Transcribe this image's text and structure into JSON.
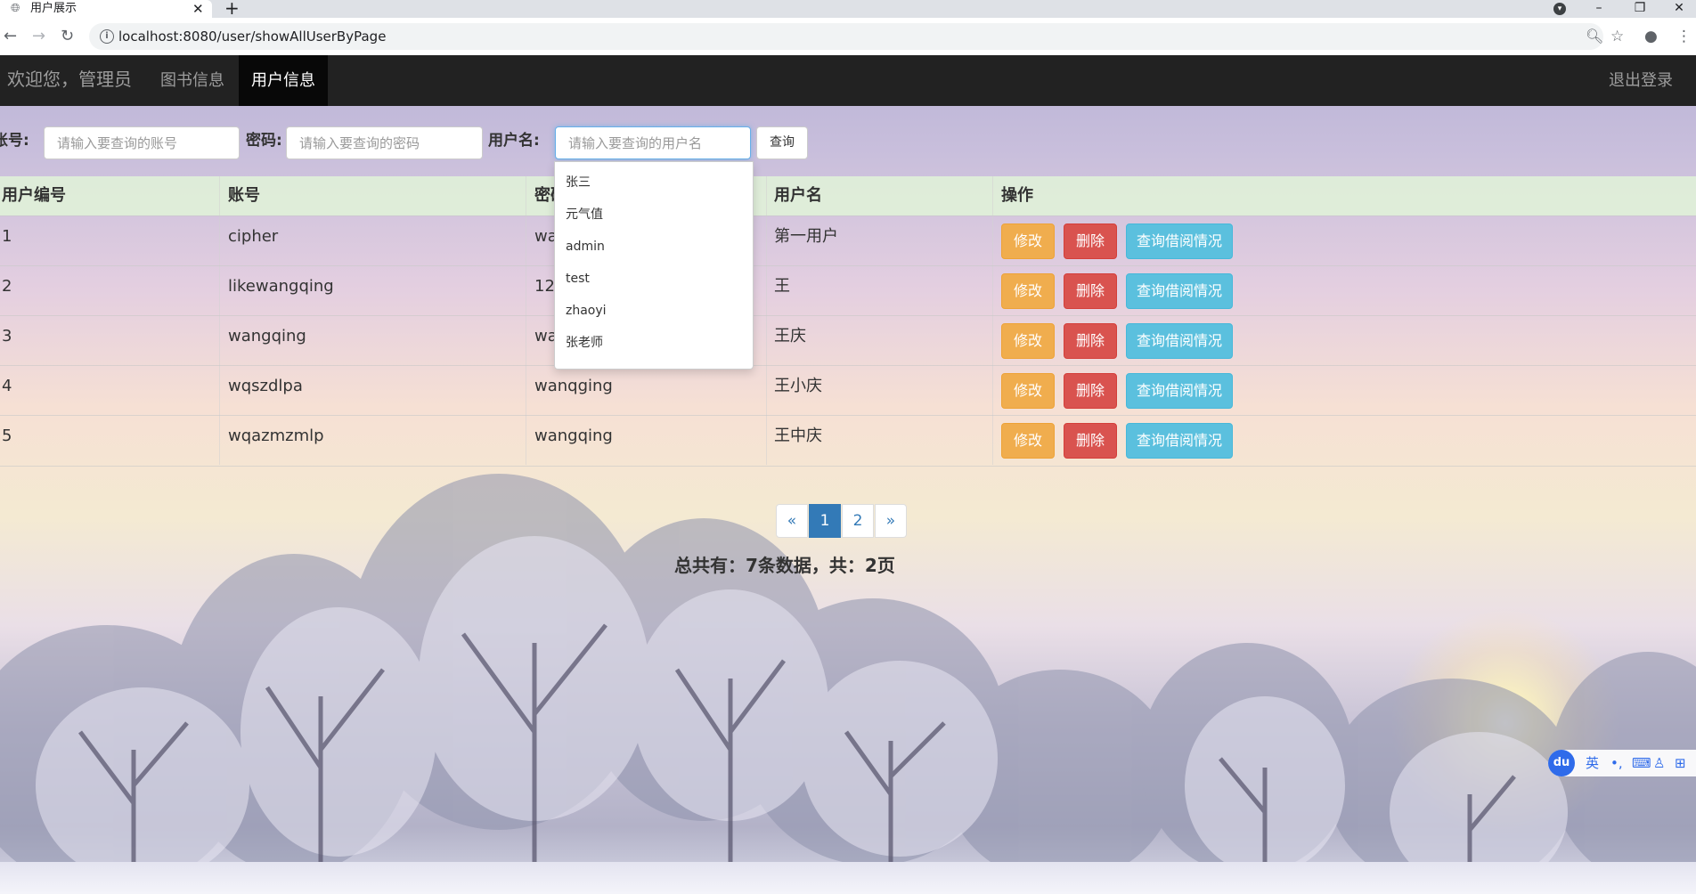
{
  "browser": {
    "tab_title": "用户展示",
    "new_tab": "+",
    "close_tab": "✕",
    "url": "localhost:8080/user/showAllUserByPage",
    "controls": {
      "minimize": "–",
      "restore": "❐",
      "close": "✕"
    }
  },
  "navbar": {
    "brand": "欢迎您，管理员",
    "links": [
      {
        "label": "图书信息"
      },
      {
        "label": "用户信息"
      }
    ],
    "logout": "退出登录"
  },
  "search": {
    "account_label": "账号:",
    "account_placeholder": "请输入要查询的账号",
    "password_label": "密码:",
    "password_placeholder": "请输入要查询的密码",
    "username_label": "用户名:",
    "username_placeholder": "请输入要查询的用户名",
    "button": "查询",
    "suggestions": [
      "张三",
      "元气值",
      "admin",
      "test",
      "zhaoyi",
      "张老师"
    ]
  },
  "table": {
    "headers": [
      "用户编号",
      "账号",
      "密码",
      "用户名",
      "操作"
    ],
    "rows": [
      {
        "id": "1",
        "account": "cipher",
        "password": "wangqing",
        "username": "第一用户"
      },
      {
        "id": "2",
        "account": "likewangqing",
        "password": "123",
        "username": "王"
      },
      {
        "id": "3",
        "account": "wangqing",
        "password": "wangqing",
        "username": "王庆"
      },
      {
        "id": "4",
        "account": "wqszdlpa",
        "password": "wanqging",
        "username": "王小庆"
      },
      {
        "id": "5",
        "account": "wqazmzmlp",
        "password": "wangqing",
        "username": "王中庆"
      }
    ],
    "actions": {
      "edit": "修改",
      "delete": "删除",
      "borrow": "查询借阅情况"
    }
  },
  "pagination": {
    "prev": "«",
    "pages": [
      "1",
      "2"
    ],
    "current": "1",
    "next": "»"
  },
  "summary": "总共有：7条数据，共：2页",
  "ime": {
    "logo": "du",
    "mode": "英"
  },
  "colors": {
    "navbar": "#222222",
    "header_row": "#dff0d8",
    "warning": "#f0ad4e",
    "danger": "#d9534f",
    "info": "#5bc0de",
    "primary": "#337ab7"
  }
}
